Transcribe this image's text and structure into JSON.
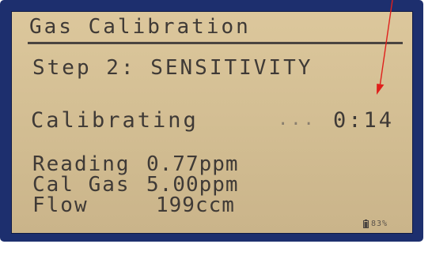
{
  "screen": {
    "title": "Gas Calibration",
    "step": "Step 2: SENSITIVITY",
    "status": {
      "label": "Calibrating",
      "dots": "...",
      "timer": "0:14"
    },
    "readings": [
      {
        "label": "Reading",
        "value": "0.77ppm"
      },
      {
        "label": "Cal Gas",
        "value": "5.00ppm"
      },
      {
        "label": "Flow",
        "value": "199ccm"
      }
    ],
    "battery": {
      "icon": "battery-icon",
      "percent": "83%"
    }
  },
  "annotation": {
    "icon": "red-arrow-icon",
    "color": "#e0201c"
  },
  "colors": {
    "bezel": "#1d2f6e",
    "lcd_background": "#d6c195",
    "lcd_text": "#3f3a36"
  }
}
